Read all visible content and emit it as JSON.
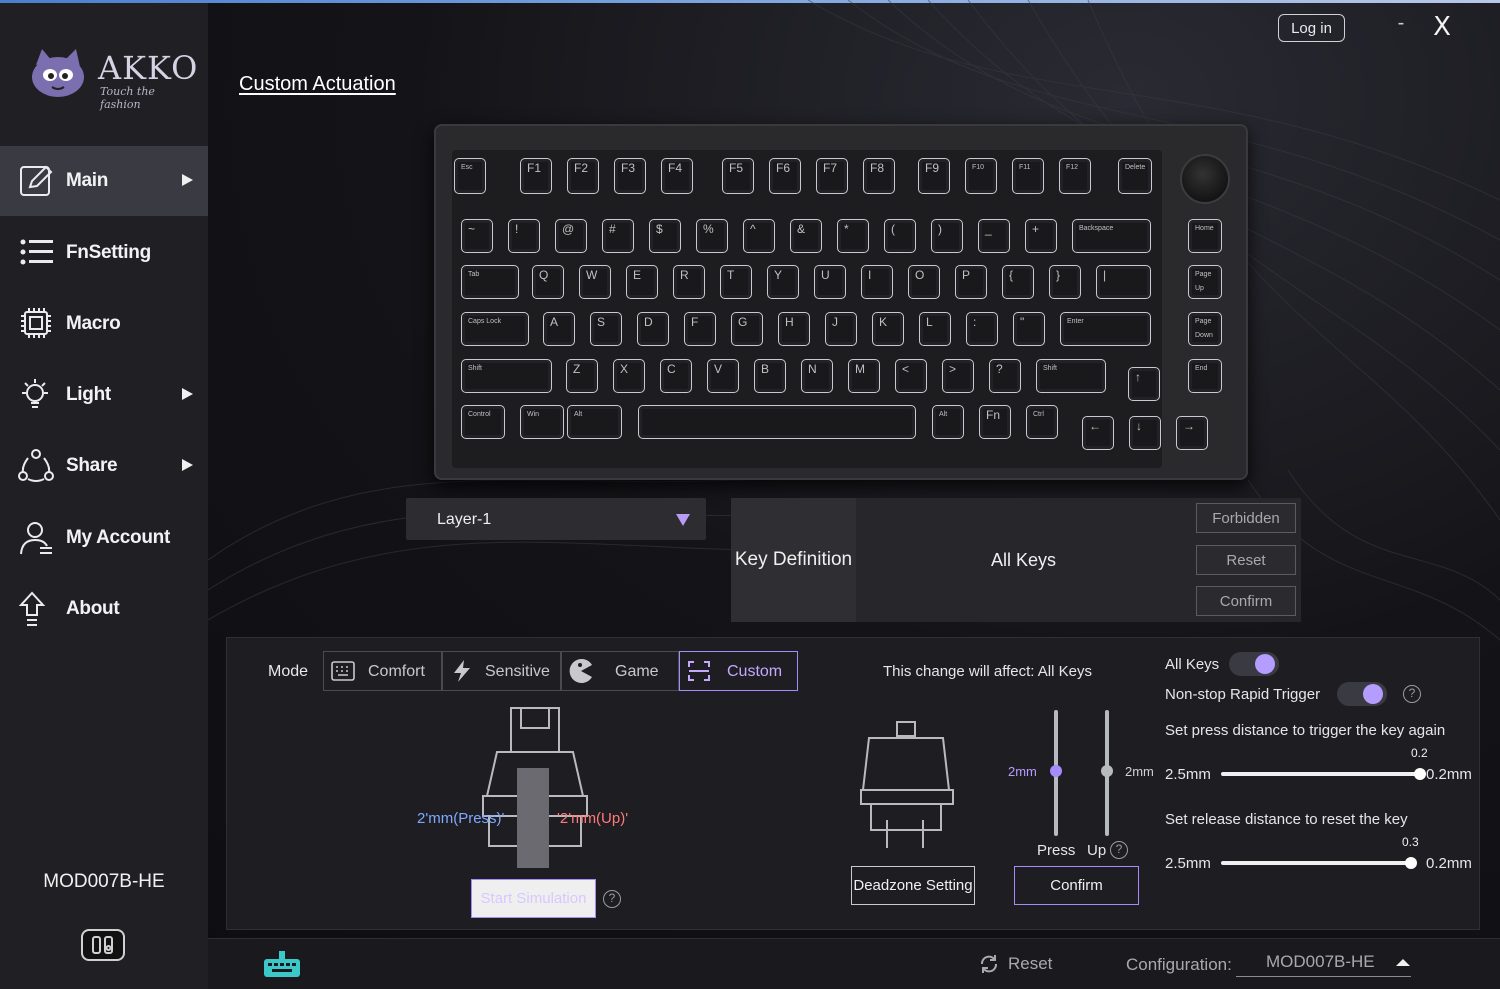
{
  "app": {
    "brand": "AKKO",
    "tagline": "Touch the fashion",
    "login": "Log in",
    "minimize": "-",
    "close": "X",
    "page_title": "Custom Actuation"
  },
  "sidebar": {
    "items": [
      {
        "label": "Main",
        "icon": "edit-icon",
        "arrow": true,
        "active": true
      },
      {
        "label": "FnSetting",
        "icon": "list-icon",
        "arrow": false
      },
      {
        "label": "Macro",
        "icon": "chip-icon",
        "arrow": false
      },
      {
        "label": "Light",
        "icon": "bulb-icon",
        "arrow": true
      },
      {
        "label": "Share",
        "icon": "share-icon",
        "arrow": true
      },
      {
        "label": "My Account",
        "icon": "user-icon",
        "arrow": false
      },
      {
        "label": "About",
        "icon": "upload-icon",
        "arrow": false
      }
    ],
    "device": "MOD007B-HE"
  },
  "keyboard": {
    "keys": [
      "Esc",
      "F1",
      "F2",
      "F3",
      "F4",
      "F5",
      "F6",
      "F7",
      "F8",
      "F9",
      "F10",
      "F11",
      "F12",
      "Delete",
      "~",
      "!",
      "@",
      "#",
      "$",
      "%",
      "^",
      "&",
      "*",
      "(",
      ")",
      "_",
      "+",
      "Backspace",
      "Home",
      "Tab",
      "Q",
      "W",
      "E",
      "R",
      "T",
      "Y",
      "U",
      "I",
      "O",
      "P",
      "{",
      "}",
      "|",
      "Page Up",
      "Caps Lock",
      "A",
      "S",
      "D",
      "F",
      "G",
      "H",
      "J",
      "K",
      "L",
      ":",
      "\"",
      "Enter",
      "Page Down",
      "Shift",
      "Z",
      "X",
      "C",
      "V",
      "B",
      "N",
      "M",
      "<",
      ">",
      "?",
      "Shift",
      "↑",
      "End",
      "Control",
      "Win",
      "Alt",
      "",
      "Alt",
      "Fn",
      "Ctrl",
      "←",
      "↓",
      "→"
    ]
  },
  "layer": {
    "selected": "Layer-1"
  },
  "key_definition": {
    "title": "Key Definition",
    "value": "All Keys",
    "buttons": {
      "forbidden": "Forbidden",
      "reset": "Reset",
      "confirm": "Confirm"
    }
  },
  "mode": {
    "label": "Mode",
    "options": [
      {
        "label": "Comfort",
        "icon": "keyboard-icon"
      },
      {
        "label": "Sensitive",
        "icon": "bolt-icon"
      },
      {
        "label": "Game",
        "icon": "pacman-icon"
      },
      {
        "label": "Custom",
        "icon": "custom-frame-icon",
        "selected": true
      }
    ],
    "press_label": "2'mm(Press)'",
    "up_label": "'2'mm(Up)'",
    "simulation_button": "Start Simulation"
  },
  "deadzone": {
    "affect_text": "This change will affect:  All Keys",
    "press_value": "2mm",
    "up_value": "2mm",
    "press_label": "Press",
    "up_label": "Up",
    "deadzone_button": "Deadzone Setting",
    "confirm_button": "Confirm"
  },
  "rapid": {
    "all_keys_label": "All Keys",
    "all_keys_on": true,
    "nonstop_label": "Non-stop Rapid Trigger",
    "nonstop_on": true,
    "press_again_label": "Set press distance to trigger the key again",
    "press_again_value": "0.2",
    "press_again_min": "2.5mm",
    "press_again_max": "0.2mm",
    "release_label": "Set release distance to reset the key",
    "release_value": "0.3",
    "release_min": "2.5mm",
    "release_max": "0.2mm"
  },
  "status": {
    "reset": "Reset",
    "configuration_label": "Configuration:",
    "configuration_value": "MOD007B-HE"
  },
  "colors": {
    "accent": "#a78bfa",
    "press": "#7fa8ff",
    "up": "#ff7a7a"
  }
}
